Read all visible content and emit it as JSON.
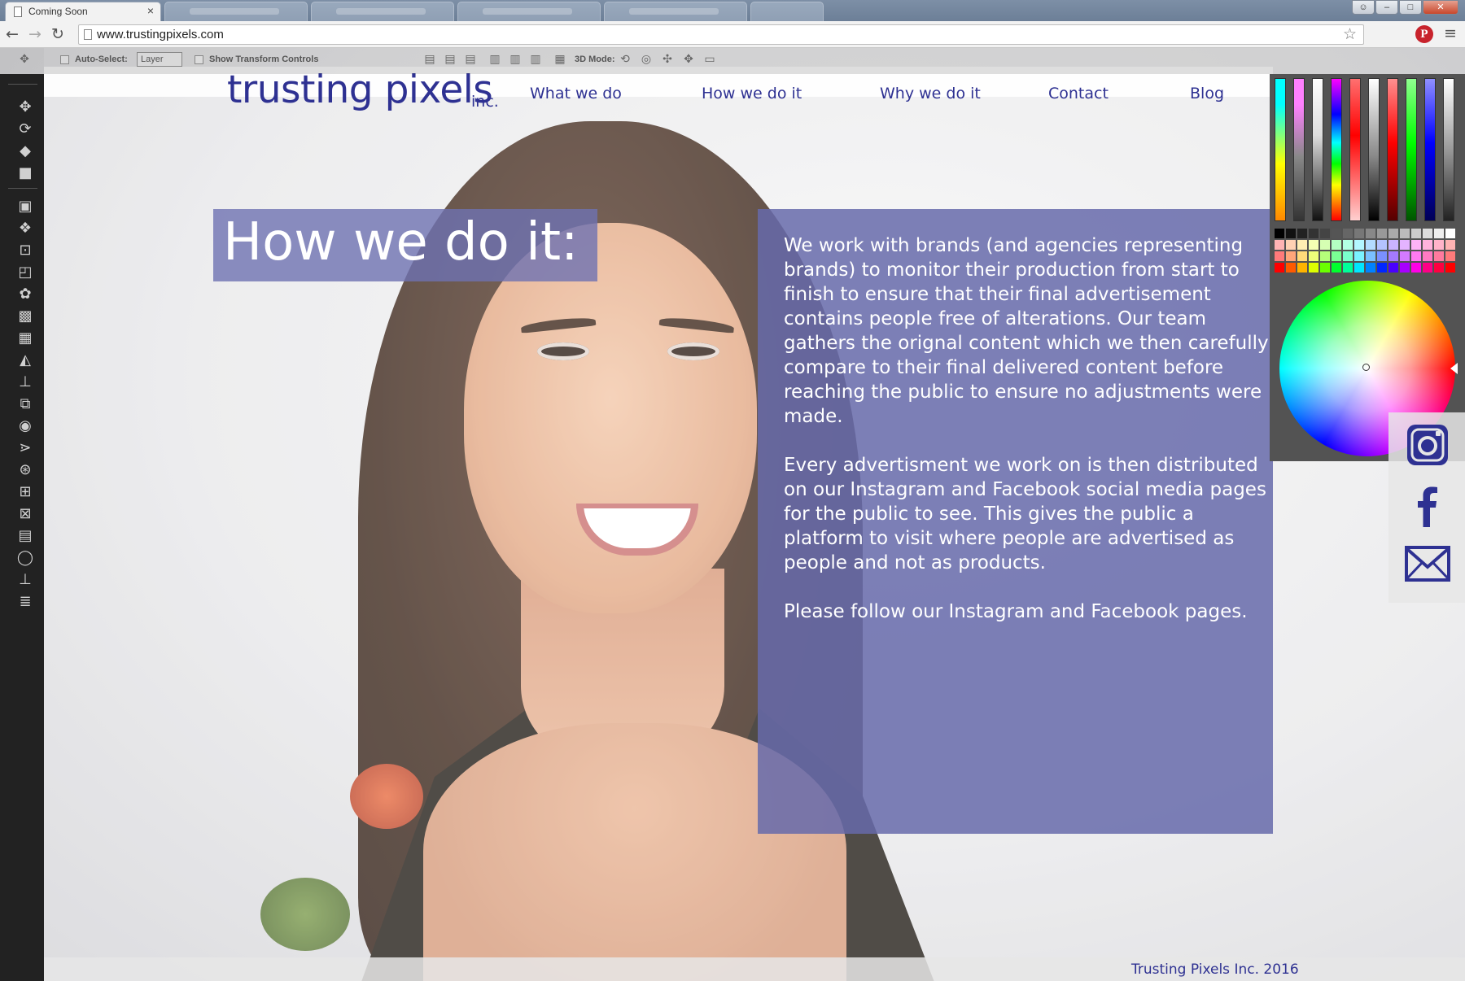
{
  "browser": {
    "tab_title": "Coming Soon",
    "tab_close": "×",
    "url": "www.trustingpixels.com"
  },
  "site": {
    "logo_text": "trusting pixels",
    "logo_suffix": "inc.",
    "nav": [
      "What we do",
      "How we do it",
      "Why we do it",
      "Contact",
      "Blog"
    ],
    "heading": "How we do it:",
    "paragraphs": [
      "We work with brands (and agencies representing brands) to monitor their production from start to finish to ensure that their final advertisement contains people free of alterations.  Our team gathers the orignal content  which we then carefully compare to their final delivered content before reaching the public to ensure no adjustments were made.",
      "Every advertisment we work on is then distributed on our Instagram and Facebook social media pages for the public to see. This gives the public a platform to visit where people are advertised as people and not as products.",
      "Please follow our Instagram and Facebook pages."
    ],
    "footer": "Trusting Pixels Inc. 2016",
    "social": [
      "instagram-icon",
      "facebook-icon",
      "email-icon"
    ]
  },
  "photoshop": {
    "auto_select_label": "Auto-Select:",
    "auto_select_value": "Layer",
    "transform_label": "Show Transform Controls",
    "mode_label": "3D Mode:"
  },
  "colors": {
    "brand_navy": "#2e3192",
    "overlay_purple": "#666aaa"
  }
}
